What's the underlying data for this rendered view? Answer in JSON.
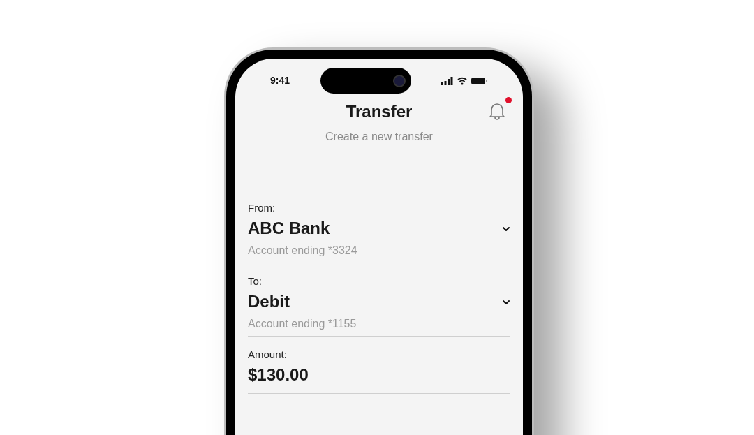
{
  "status_bar": {
    "time": "9:41"
  },
  "header": {
    "title": "Transfer",
    "subtitle": "Create a new transfer",
    "notification_badge": true
  },
  "fields": [
    {
      "kind": "select",
      "label": "From:",
      "value": "ABC Bank",
      "detail": "Account ending *3324"
    },
    {
      "kind": "select",
      "label": "To:",
      "value": "Debit",
      "detail": "Account ending *1155"
    },
    {
      "kind": "amount",
      "label": "Amount:",
      "value": "$130.00"
    }
  ]
}
